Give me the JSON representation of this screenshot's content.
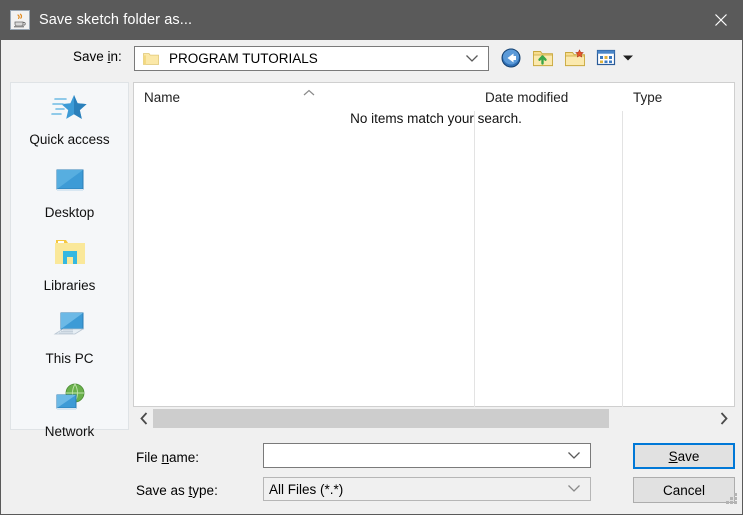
{
  "window": {
    "title": "Save sketch folder as...",
    "app_icon": "java-coffee-cup-icon",
    "close_label": "✕",
    "titlebar_color": "#5a5a5a",
    "accent_color": "#0078d7"
  },
  "savein": {
    "label_pre": "Save ",
    "label_mnemonic": "i",
    "label_post": "n:",
    "label_full": "Save in:",
    "value": "PROGRAM TUTORIALS",
    "folder_icon": "folder-icon",
    "caret_icon": "chevron-down-icon"
  },
  "toolbar": {
    "buttons": [
      {
        "name": "back-button",
        "icon": "back-arrow-icon",
        "label": "Back"
      },
      {
        "name": "up-one-level-button",
        "icon": "folder-up-icon",
        "label": "Up One Level"
      },
      {
        "name": "create-new-folder-button",
        "icon": "new-folder-icon",
        "label": "Create New Folder"
      },
      {
        "name": "view-menu-button",
        "icon": "view-grid-icon",
        "label": "View Menu"
      }
    ],
    "view_dropdown_icon": "caret-down-icon"
  },
  "places": {
    "items": [
      {
        "label": "Quick access",
        "icon": "star-icon"
      },
      {
        "label": "Desktop",
        "icon": "monitor-icon"
      },
      {
        "label": "Libraries",
        "icon": "libraries-folder-icon"
      },
      {
        "label": "This PC",
        "icon": "computer-icon"
      },
      {
        "label": "Network",
        "icon": "network-globe-icon"
      }
    ]
  },
  "filelist": {
    "columns": [
      {
        "label": "Name",
        "sorted": "ascending",
        "sort_icon": "caret-up-icon"
      },
      {
        "label": "Date modified",
        "sorted": ""
      },
      {
        "label": "Type",
        "sorted": ""
      }
    ],
    "rows": [],
    "empty_message": "No items match your search.",
    "scrollbar": {
      "left_arrow": "‹",
      "right_arrow": "›"
    }
  },
  "form": {
    "filename": {
      "label_pre": "File ",
      "label_mnemonic": "n",
      "label_post": "ame:",
      "label_full": "File name:",
      "value": "",
      "placeholder": "",
      "caret_icon": "chevron-down-icon"
    },
    "savetype": {
      "label_pre": "Save as ",
      "label_mnemonic": "t",
      "label_post": "ype:",
      "label_full": "Save as type:",
      "value": "All Files (*.*)",
      "options": [
        "All Files (*.*)"
      ],
      "caret_icon": "chevron-down-icon"
    }
  },
  "actions": {
    "save": {
      "pre": "",
      "mnemonic": "S",
      "post": "ave",
      "full": "Save",
      "focused": true
    },
    "cancel": {
      "pre": "",
      "mnemonic": "",
      "post": "Cancel",
      "full": "Cancel",
      "focused": false
    }
  }
}
